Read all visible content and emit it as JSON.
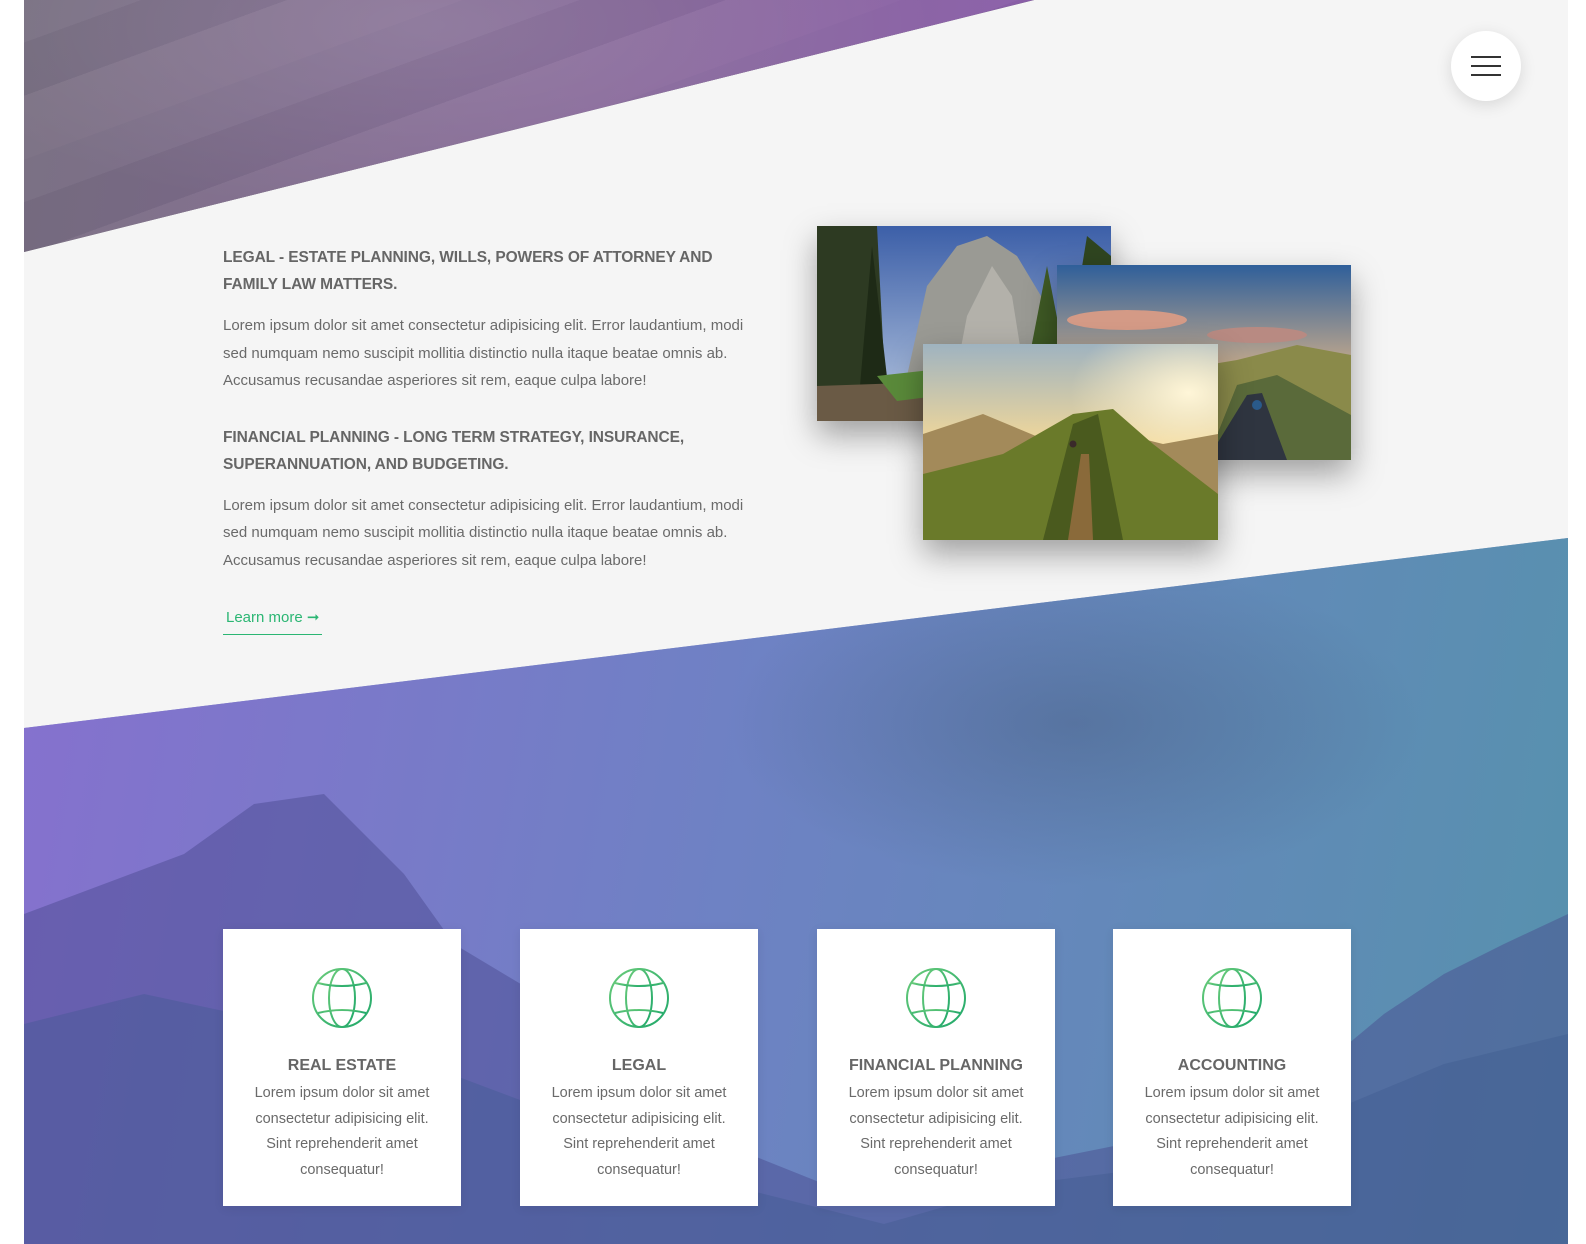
{
  "menu": {
    "icon": "hamburger-menu-icon"
  },
  "sections": [
    {
      "title": "LEGAL - ESTATE PLANNING, WILLS, POWERS OF ATTORNEY AND FAMILY LAW MATTERS.",
      "body": "Lorem ipsum dolor sit amet consectetur adipisicing elit. Error laudantium, modi sed numquam nemo suscipit mollitia distinctio nulla itaque beatae omnis ab. Accusamus recusandae asperiores sit rem, eaque culpa labore!"
    },
    {
      "title": "FINANCIAL PLANNING - LONG TERM STRATEGY, INSURANCE, SUPERANNUATION, AND BUDGETING.",
      "body": "Lorem ipsum dolor sit amet consectetur adipisicing elit. Error laudantium, modi sed numquam nemo suscipit mollitia distinctio nulla itaque beatae omnis ab. Accusamus recusandae asperiores sit rem, eaque culpa labore!"
    }
  ],
  "learn_more": {
    "label": "Learn more ➞",
    "icon": "arrow-right-icon"
  },
  "photos": [
    "forest-cliff-photo",
    "cyclist-road-photo",
    "mountain-ridge-hiker-photo"
  ],
  "cards": [
    {
      "icon": "globe-icon",
      "title": "REAL ESTATE",
      "text": "Lorem ipsum dolor sit amet consectetur adipisicing elit. Sint reprehenderit amet consequatur!"
    },
    {
      "icon": "globe-icon",
      "title": "LEGAL",
      "text": "Lorem ipsum dolor sit amet consectetur adipisicing elit. Sint reprehenderit amet consequatur!"
    },
    {
      "icon": "globe-icon",
      "title": "FINANCIAL PLANNING",
      "text": "Lorem ipsum dolor sit amet consectetur adipisicing elit. Sint reprehenderit amet consequatur!"
    },
    {
      "icon": "globe-icon",
      "title": "ACCOUNTING",
      "text": "Lorem ipsum dolor sit amet consectetur adipisicing elit. Sint reprehenderit amet consequatur!"
    }
  ],
  "colors": {
    "accent": "#2bb673",
    "heading": "#666666",
    "body_text": "#6a6a6a",
    "background": "#f5f5f5",
    "band_gradient_start": "#8a6ed2",
    "band_gradient_end": "#5096aa"
  }
}
